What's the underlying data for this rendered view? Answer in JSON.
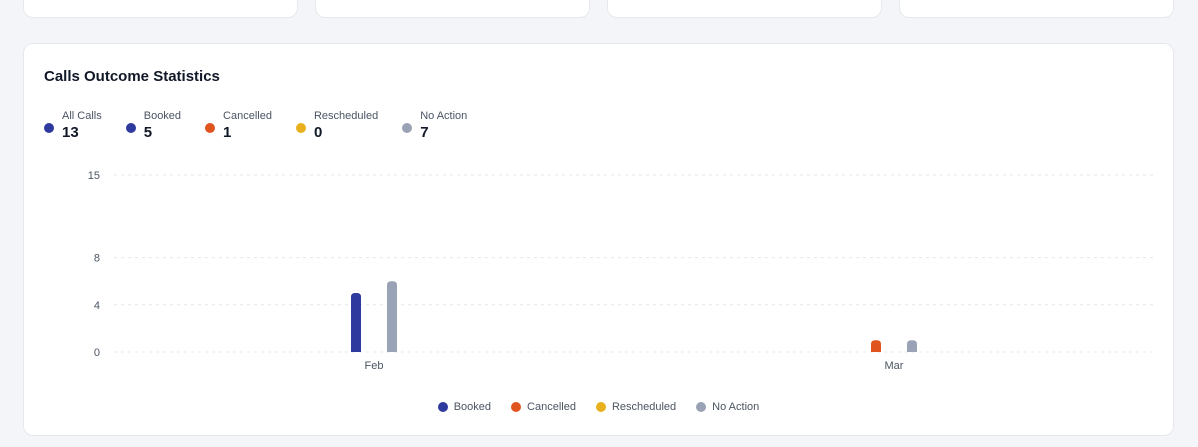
{
  "panel": {
    "title": "Calls Outcome Statistics"
  },
  "stats": [
    {
      "label": "All Calls",
      "value": "13",
      "color": "#2e3a9e"
    },
    {
      "label": "Booked",
      "value": "5",
      "color": "#2e3a9e"
    },
    {
      "label": "Cancelled",
      "value": "1",
      "color": "#e0541f"
    },
    {
      "label": "Rescheduled",
      "value": "0",
      "color": "#e8b01c"
    },
    {
      "label": "No Action",
      "value": "7",
      "color": "#9aa3b5"
    }
  ],
  "chart_data": {
    "type": "bar",
    "categories": [
      "Feb",
      "Mar"
    ],
    "series": [
      {
        "name": "Booked",
        "color": "#2e3a9e",
        "values": [
          5,
          0
        ]
      },
      {
        "name": "Cancelled",
        "color": "#e0541f",
        "values": [
          0,
          1
        ]
      },
      {
        "name": "Rescheduled",
        "color": "#e8b01c",
        "values": [
          0,
          0
        ]
      },
      {
        "name": "No Action",
        "color": "#9aa3b5",
        "values": [
          6,
          1
        ]
      }
    ],
    "yticks": [
      0,
      4,
      8,
      15
    ],
    "ylim": [
      0,
      15
    ],
    "grid": true,
    "legend": "bottom-center"
  }
}
